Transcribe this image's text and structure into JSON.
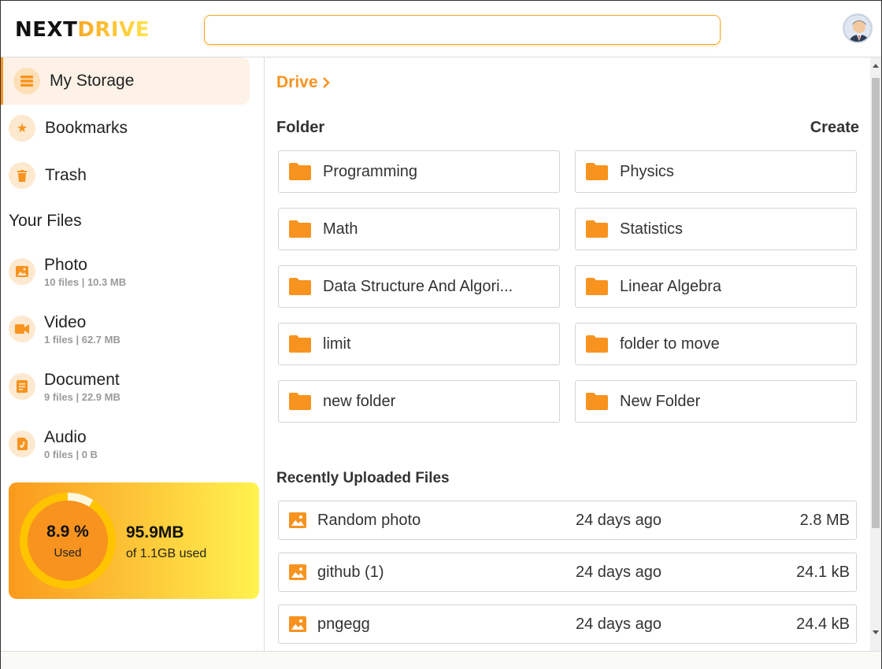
{
  "app": {
    "logo_part1": "NEXT",
    "logo_part2": "DRIVE",
    "accent_color": "#f7931e",
    "search": {
      "value": "",
      "placeholder": ""
    }
  },
  "sidebar": {
    "nav": [
      {
        "label": "My Storage",
        "icon": "storage-list-icon",
        "active": true
      },
      {
        "label": "Bookmarks",
        "icon": "star-icon",
        "active": false
      },
      {
        "label": "Trash",
        "icon": "trash-icon",
        "active": false
      }
    ],
    "section_title": "Your Files",
    "file_types": [
      {
        "name": "Photo",
        "meta": "10 files | 10.3 MB",
        "icon": "image-icon"
      },
      {
        "name": "Video",
        "meta": "1 files | 62.7 MB",
        "icon": "video-camera-icon"
      },
      {
        "name": "Document",
        "meta": "9 files | 22.9 MB",
        "icon": "document-icon"
      },
      {
        "name": "Audio",
        "meta": "0 files | 0 B",
        "icon": "audio-file-icon"
      }
    ],
    "storage": {
      "percent": "8.9 %",
      "percent_value": 8.9,
      "used_label": "Used",
      "amount": "95.9MB",
      "of_total": "of 1.1GB used"
    }
  },
  "main": {
    "breadcrumb": "Drive",
    "folder_title": "Folder",
    "create_label": "Create",
    "folders": [
      "Programming",
      "Physics",
      "Math",
      "Statistics",
      "Data Structure And Algori...",
      "Linear Algebra",
      "limit",
      "folder to move",
      "new folder",
      "New Folder"
    ],
    "recent_title": "Recently Uploaded Files",
    "recent_files": [
      {
        "name": "Random photo",
        "date": "24 days ago",
        "size": "2.8 MB"
      },
      {
        "name": "github (1)",
        "date": "24 days ago",
        "size": "24.1 kB"
      },
      {
        "name": "pngegg",
        "date": "24 days ago",
        "size": "24.4 kB"
      }
    ]
  }
}
